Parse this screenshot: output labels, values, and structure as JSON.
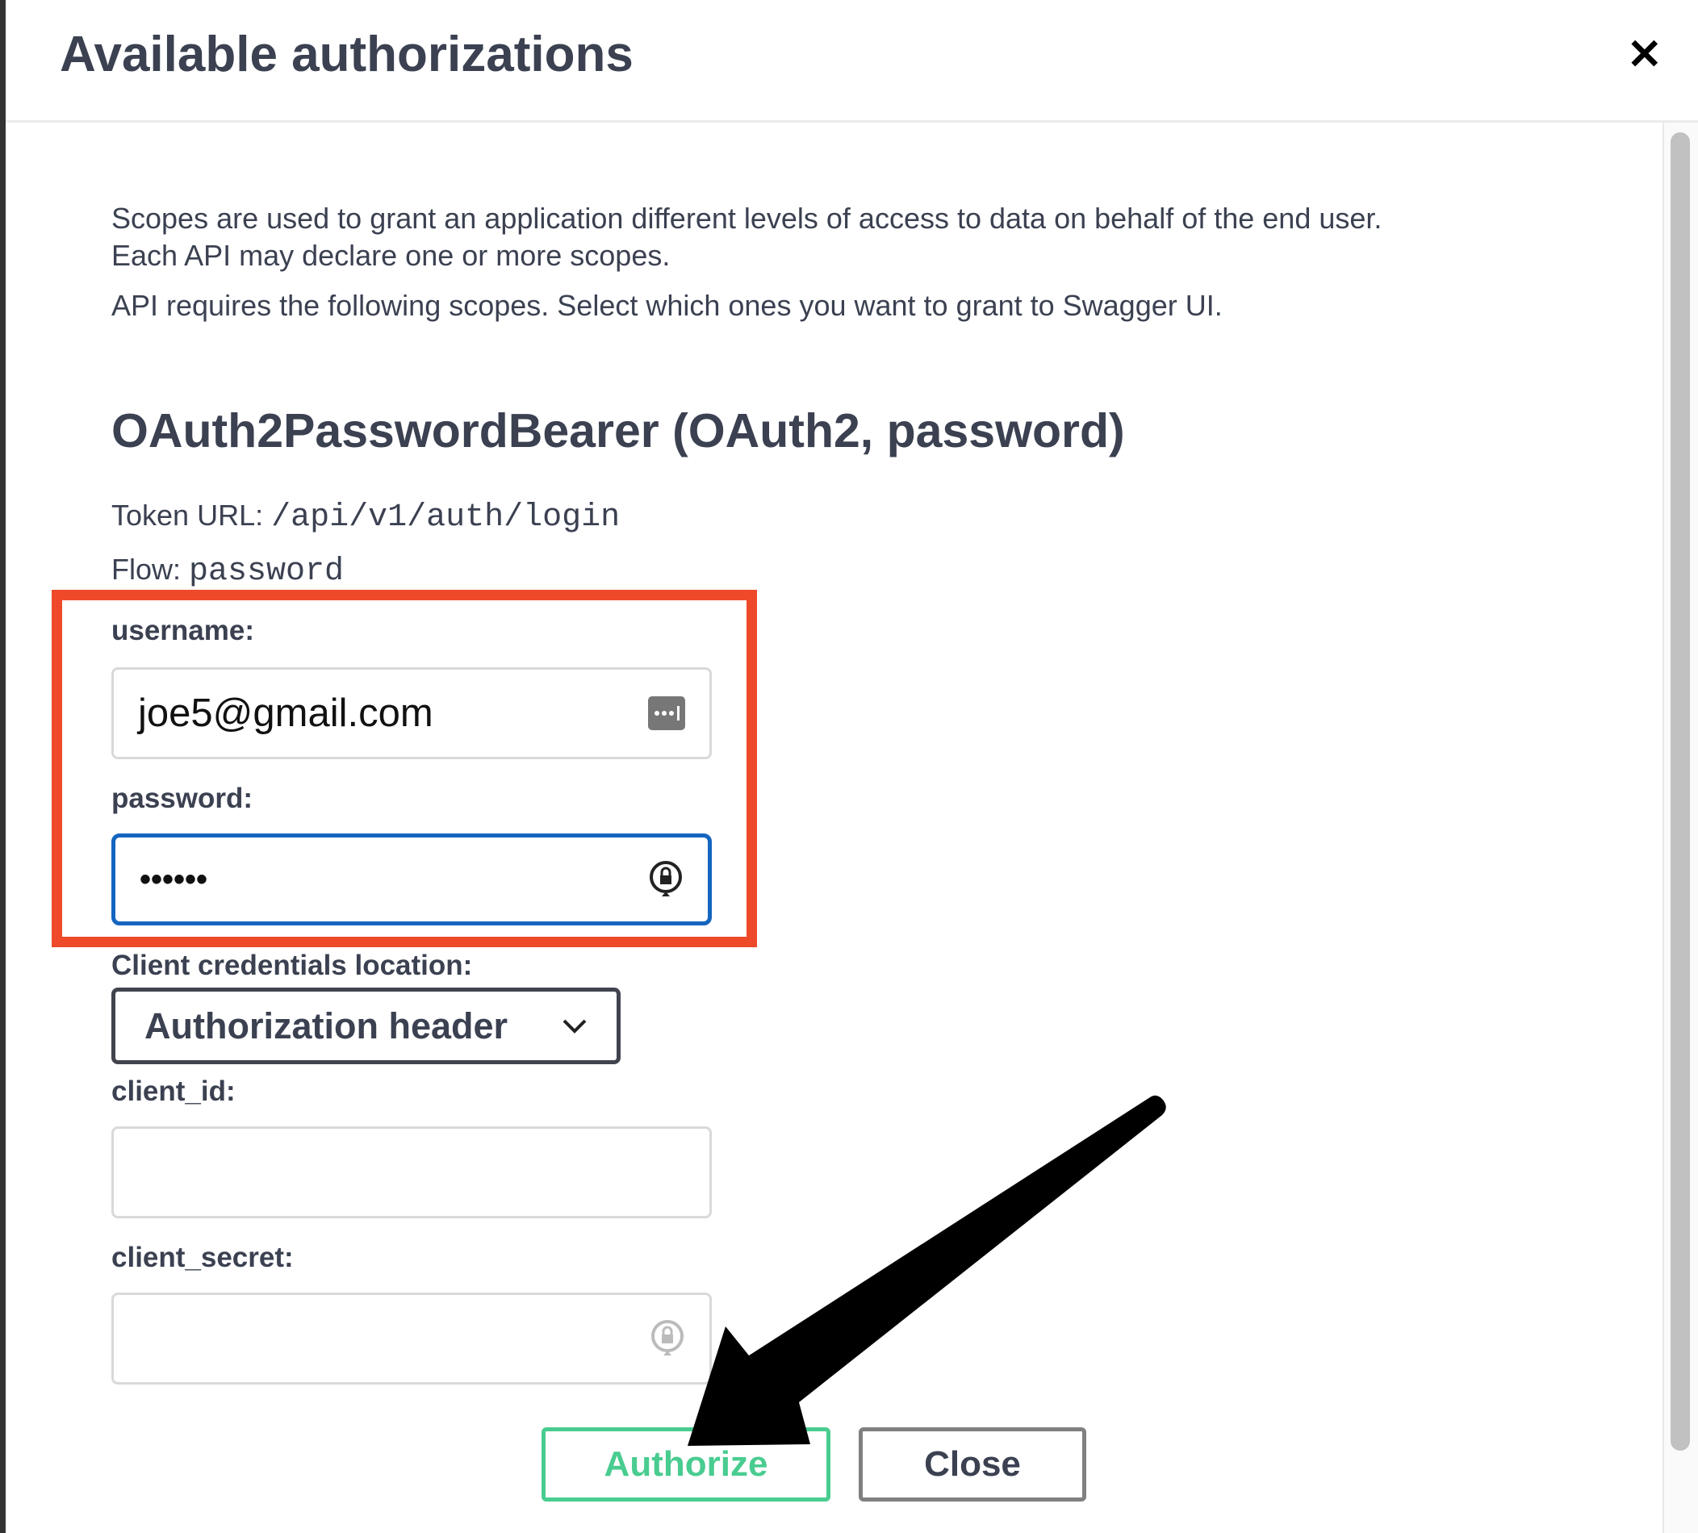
{
  "dialog": {
    "title": "Available authorizations",
    "close_icon": "close-x-icon"
  },
  "intro": {
    "line1": "Scopes are used to grant an application different levels of access to data on behalf of the end user.",
    "line2": "Each API may declare one or more scopes.",
    "line3": "API requires the following scopes. Select which ones you want to grant to Swagger UI."
  },
  "scheme": {
    "heading": "OAuth2PasswordBearer (OAuth2, password)",
    "token_url_label": "Token URL:",
    "token_url": "/api/v1/auth/login",
    "flow_label": "Flow:",
    "flow": "password"
  },
  "form": {
    "username_label": "username:",
    "username_value": "joe5@gmail.com",
    "password_label": "password:",
    "password_value": "••••••",
    "location_label": "Client credentials location:",
    "location_value": "Authorization header",
    "client_id_label": "client_id:",
    "client_id_value": "",
    "client_secret_label": "client_secret:",
    "client_secret_value": ""
  },
  "buttons": {
    "authorize": "Authorize",
    "close": "Close"
  },
  "colors": {
    "highlight": "#ee4a2a",
    "authorize": "#49cc90",
    "focus": "#1565c0"
  }
}
